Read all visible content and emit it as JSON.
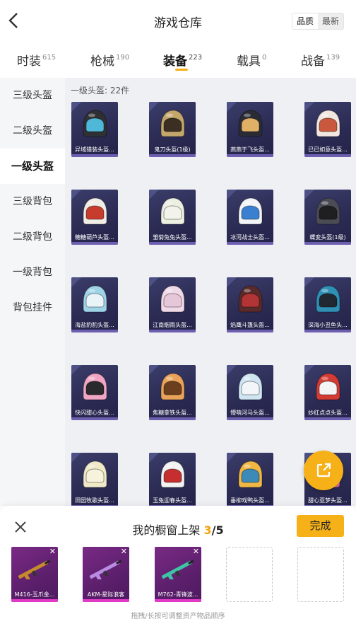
{
  "header": {
    "title": "游戏仓库",
    "sort_options": [
      "品质",
      "最新"
    ]
  },
  "tabs": [
    {
      "label": "时装",
      "count": "615",
      "active": false
    },
    {
      "label": "枪械",
      "count": "190",
      "active": false
    },
    {
      "label": "装备",
      "count": "223",
      "active": true
    },
    {
      "label": "载具",
      "count": "0",
      "active": false
    },
    {
      "label": "战备",
      "count": "139",
      "active": false
    }
  ],
  "sidebar": {
    "items": [
      {
        "label": "三级头盔",
        "active": false
      },
      {
        "label": "二级头盔",
        "active": false
      },
      {
        "label": "一级头盔",
        "active": true
      },
      {
        "label": "三级背包",
        "active": false
      },
      {
        "label": "二级背包",
        "active": false
      },
      {
        "label": "一级背包",
        "active": false
      },
      {
        "label": "背包挂件",
        "active": false
      }
    ]
  },
  "content": {
    "group_title": "一级头盔: 22件",
    "items": [
      {
        "name": "异域猎装头盔...",
        "helmet_color": "#2f3033",
        "visor_color": "#4fb8d8"
      },
      {
        "name": "鬼刀头盔(1级)",
        "helmet_color": "#c2a66a",
        "visor_color": "#3a2f22"
      },
      {
        "name": "燕燕于飞头盔...",
        "helmet_color": "#2a2c35",
        "visor_color": "#e0b067"
      },
      {
        "name": "已已如意头盔...",
        "helmet_color": "#f2e7e0",
        "visor_color": "#c9583e"
      },
      {
        "name": "糖糖葫芦头盔...",
        "helmet_color": "#f0ece6",
        "visor_color": "#c73c2c"
      },
      {
        "name": "雏菊兔兔头盔...",
        "helmet_color": "#ecefe2",
        "visor_color": "#f2f3ea"
      },
      {
        "name": "冰河战士头盔...",
        "helmet_color": "#f2f4f7",
        "visor_color": "#3a7fd0"
      },
      {
        "name": "蝶变头盔(1级)",
        "helmet_color": "#4a4b55",
        "visor_color": "#1f1f22"
      },
      {
        "name": "海盐豹豹头盔...",
        "helmet_color": "#9fd3e6",
        "visor_color": "#e9f4f8"
      },
      {
        "name": "江南烟雨头盔...",
        "helmet_color": "#efd9e6",
        "visor_color": "#e6c7d9"
      },
      {
        "name": "焰鹰斗篷头盔...",
        "helmet_color": "#5a2a2a",
        "visor_color": "#b33434"
      },
      {
        "name": "深海小丑鱼头...",
        "helmet_color": "#2f8fb5",
        "visor_color": "#222831"
      },
      {
        "name": "快闪甜心头盔...",
        "helmet_color": "#f0a6c2",
        "visor_color": "#2a2a2d"
      },
      {
        "name": "焦糖拿铁头盔...",
        "helmet_color": "#e8a25a",
        "visor_color": "#6b3f1e"
      },
      {
        "name": "懵萌河马头盔...",
        "helmet_color": "#cfe6f2",
        "visor_color": "#f3f6f8"
      },
      {
        "name": "炒红点点头盔...",
        "helmet_color": "#d43b33",
        "visor_color": "#f4f4f4"
      },
      {
        "name": "田园牧歌头盔...",
        "helmet_color": "#efe9c8",
        "visor_color": "#f7f2dc"
      },
      {
        "name": "玉兔迎春头盔...",
        "helmet_color": "#f2f2f2",
        "visor_color": "#c52f2f"
      },
      {
        "name": "垂柳戏鸭头盔...",
        "helmet_color": "#f0b744",
        "visor_color": "#3d8ab8"
      },
      {
        "name": "甜心亚梦头盔...",
        "helmet_color": "#e06da6",
        "visor_color": "#2a2a2d"
      }
    ]
  },
  "tray": {
    "title": "我的橱窗上架",
    "count": "3",
    "total": "/5",
    "done_label": "完成",
    "slots": [
      {
        "name": "M416-玉爪金...",
        "filled": true,
        "remove": "✕",
        "gun_color": "#c48a2c"
      },
      {
        "name": "AKM-星际浪客",
        "filled": true,
        "remove": "✕",
        "gun_color": "#b98be3"
      },
      {
        "name": "M762-青锋波...",
        "filled": true,
        "remove": "✕",
        "gun_color": "#3ec3a5"
      },
      {
        "filled": false
      },
      {
        "filled": false
      }
    ],
    "hint": "拖拽/长按可调整资产物品顺序"
  }
}
